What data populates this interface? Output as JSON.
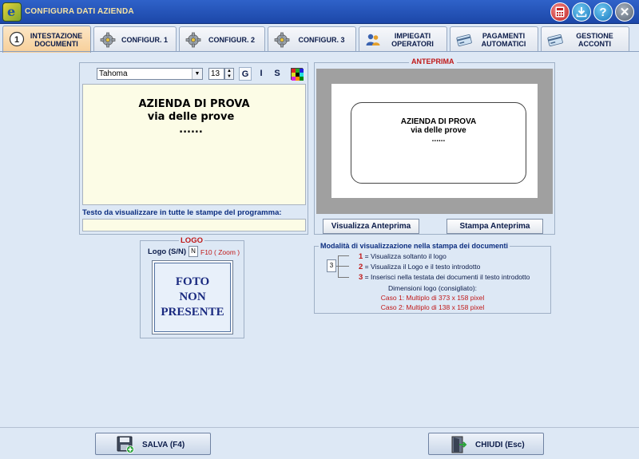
{
  "window": {
    "title": "CONFIGURA DATI AZIENDA",
    "app_logo_letter": "e",
    "buttons": [
      "calculator-icon",
      "download-icon",
      "help-icon",
      "close-icon"
    ],
    "help_glyph": "?",
    "close_glyph": "✕"
  },
  "tabs": [
    {
      "label": "INTESTAZIONE DOCUMENTI",
      "icon": "number-one-icon",
      "active": true
    },
    {
      "label": "CONFIGUR. 1",
      "icon": "gear-icon",
      "active": false
    },
    {
      "label": "CONFIGUR. 2",
      "icon": "gear-icon",
      "active": false
    },
    {
      "label": "CONFIGUR. 3",
      "icon": "gear-icon",
      "active": false
    },
    {
      "label": "IMPIEGATI OPERATORI",
      "icon": "users-icon",
      "active": false
    },
    {
      "label": "PAGAMENTI AUTOMATICI",
      "icon": "card-icon",
      "active": false
    },
    {
      "label": "GESTIONE ACCONTI",
      "icon": "card-icon",
      "active": false
    }
  ],
  "editor": {
    "font_name": "Tahoma",
    "font_size": "13",
    "bold_label": "G",
    "italic_label": "I",
    "underline_label": "S",
    "text_lines": [
      "AZIENDA DI PROVA",
      "via delle prove",
      "......"
    ],
    "footer_label": "Testo da visualizzare in tutte le stampe del programma:",
    "footer_value": ""
  },
  "preview": {
    "title": "ANTEPRIMA",
    "lines": [
      "AZIENDA DI PROVA",
      "via delle prove",
      "......"
    ],
    "show_button": "Visualizza Anteprima",
    "print_button": "Stampa Anteprima"
  },
  "logo": {
    "title": "LOGO",
    "yn_label": "Logo (S/N)",
    "yn_value": "N",
    "zoom_hint": "F10 ( Zoom )",
    "placeholder_lines": [
      "FOTO",
      "NON",
      "PRESENTE"
    ]
  },
  "mode": {
    "title": "Modalità di visualizzazione nella stampa dei documenti",
    "value": "3",
    "options": [
      {
        "num": "1",
        "text": " = Visualizza soltanto il logo"
      },
      {
        "num": "2",
        "text": " = Visualizza il Logo e il testo introdotto"
      },
      {
        "num": "3",
        "text": " = Inserisci nella testata dei documenti il testo introdotto"
      }
    ],
    "dimensions_header": "Dimensioni logo (consigliato):",
    "case1": "Caso 1: Multiplo di 373 x 158  pixel",
    "case2": "Caso 2: Multiplo di 138 x 158  pixel"
  },
  "footer": {
    "save_label": "SALVA (F4)",
    "close_label": "CHIUDI  (Esc)"
  },
  "colors": {
    "titlebar": "#1c47a8",
    "active_tab": "#f7cf99",
    "editor_bg": "#fcfce6",
    "accent_red": "#c01818",
    "label_blue": "#0c2e80"
  }
}
